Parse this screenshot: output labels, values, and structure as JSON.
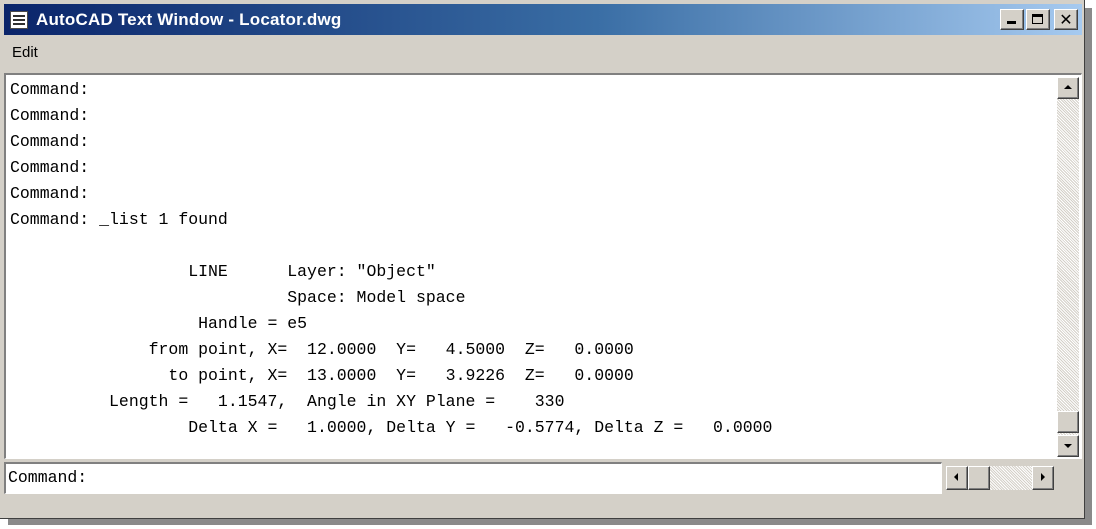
{
  "window": {
    "title": "AutoCAD Text Window - Locator.dwg",
    "icon": "text-window-icon",
    "controls": [
      "minimize-icon",
      "maximize-icon",
      "close-icon"
    ]
  },
  "menu": {
    "items": [
      {
        "label": "Edit"
      }
    ]
  },
  "history": {
    "lines": [
      "Command:",
      "Command:",
      "Command:",
      "Command:",
      "Command:",
      "Command: _list 1 found",
      "",
      "                  LINE      Layer: \"Object\"",
      "                            Space: Model space",
      "                   Handle = e5",
      "              from point, X=  12.0000  Y=   4.5000  Z=   0.0000",
      "                to point, X=  13.0000  Y=   3.9226  Z=   0.0000",
      "          Length =   1.1547,  Angle in XY Plane =    330",
      "                  Delta X =   1.0000, Delta Y =   -0.5774, Delta Z =   0.0000"
    ]
  },
  "command_line": {
    "prompt": "Command:"
  },
  "colors": {
    "title_start": "#0a246a",
    "title_end": "#a6caf0",
    "face": "#d4d0c8"
  }
}
